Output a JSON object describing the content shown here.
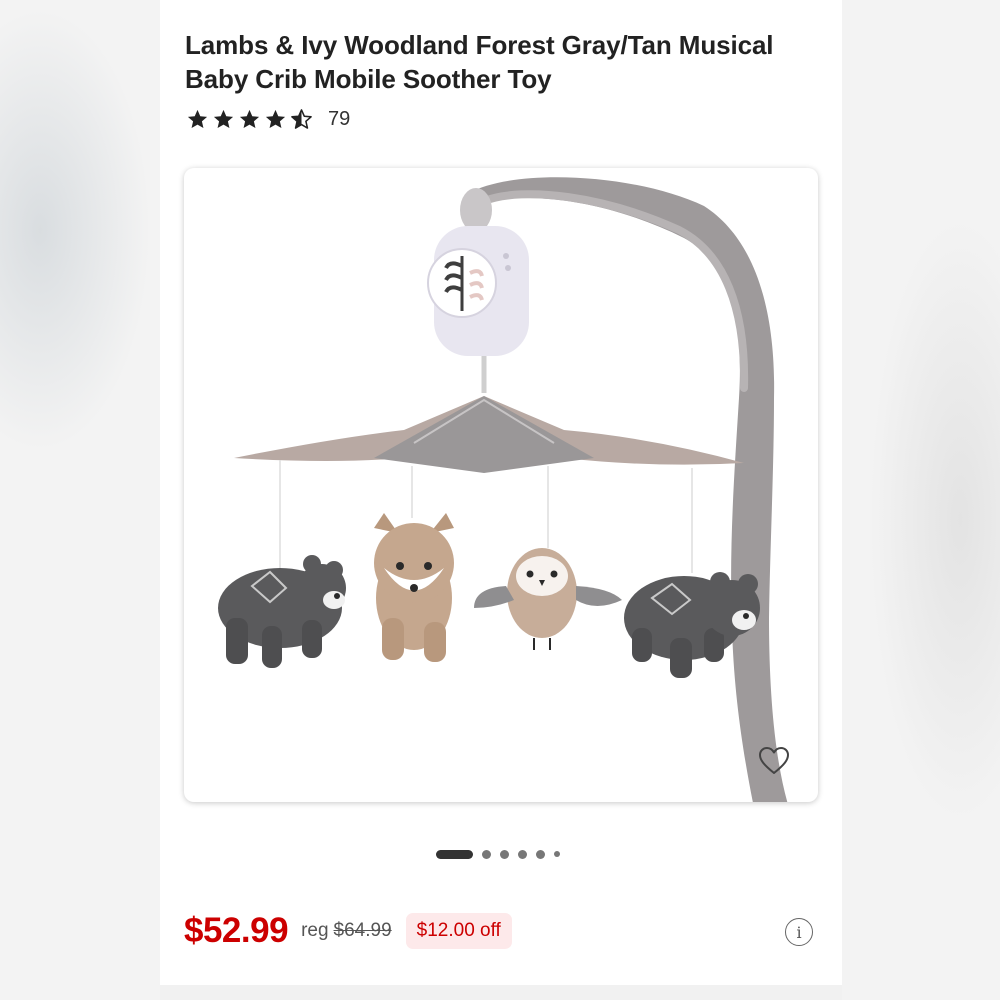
{
  "product": {
    "title": "Lambs & Ivy Woodland Forest Gray/Tan Musical Baby Crib Mobile Soother Toy",
    "rating": {
      "value": 4.5,
      "max": 5,
      "count": "79"
    },
    "image": {
      "description_icon": "product-photo",
      "favorite_icon": "heart-outline-icon"
    },
    "carousel": {
      "total_dots": 6,
      "active_index": 0
    },
    "pricing": {
      "price": "$52.99",
      "reg_label": "reg",
      "reg_price": "$64.99",
      "savings": "$12.00 off"
    },
    "info_icon_glyph": "i"
  },
  "colors": {
    "price_red": "#cc0000",
    "savings_bg": "#fde9ea",
    "text_dark": "#222222"
  }
}
